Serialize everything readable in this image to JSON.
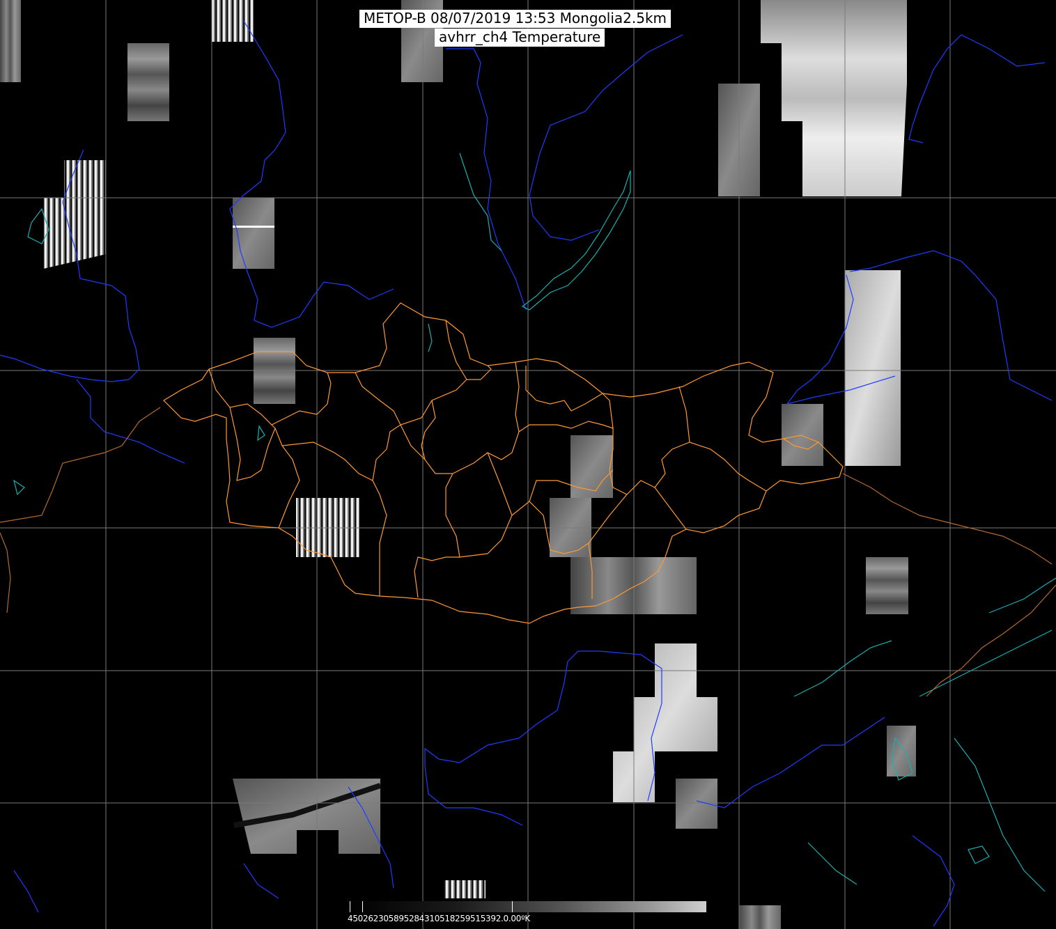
{
  "title": {
    "line1": "METOP-B 08/07/2019 13:53 Mongolia2.5km",
    "line2": "avhrr_ch4 Temperature"
  },
  "colorbar": {
    "labels": "450262305895284310518259515392.0.00ºK",
    "unit": "ºK"
  },
  "colors": {
    "background": "#000000",
    "graticule": "#7a7a7a",
    "coastline": "#1e3cff",
    "lakes": "#1ab0b0",
    "admin_borders": "#ff9933",
    "international_border": "#b36a2e",
    "label_box": "#ffffff"
  }
}
